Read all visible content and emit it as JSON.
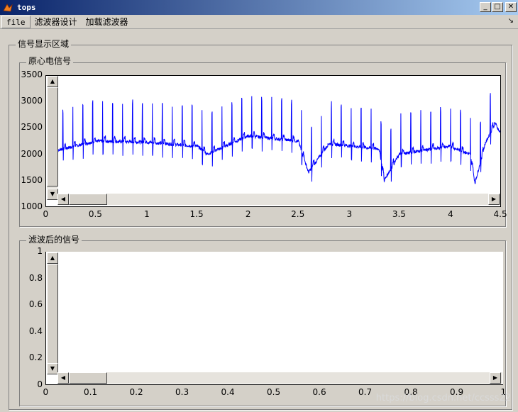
{
  "window": {
    "title": "tops"
  },
  "menu": {
    "items": [
      "file",
      "滤波器设计",
      "加载滤波器"
    ],
    "arrow": "↘"
  },
  "groups": {
    "outer": "信号显示区域",
    "top": "原心电信号",
    "bottom": "滤波后的信号"
  },
  "watermark": "https://blog.csdn.net/ccsss22",
  "chart_data": [
    {
      "type": "line",
      "title": "原心电信号",
      "xlim": [
        0,
        4.5
      ],
      "ylim": [
        1000,
        3500
      ],
      "x_ticks": [
        "0",
        "0.5",
        "1",
        "1.5",
        "2",
        "2.5",
        "3",
        "3.5",
        "4",
        "4.5"
      ],
      "y_ticks": [
        "1000",
        "1500",
        "2000",
        "2500",
        "3000",
        "3500"
      ],
      "grid": false,
      "series": [
        {
          "color": "#0000ff",
          "description_points": [
            [
              0.12,
              2080
            ],
            [
              0.5,
              2250
            ],
            [
              1.0,
              2230
            ],
            [
              1.5,
              2150
            ],
            [
              1.6,
              2000
            ],
            [
              2.0,
              2350
            ],
            [
              2.5,
              2250
            ],
            [
              2.6,
              1650
            ],
            [
              2.8,
              2200
            ],
            [
              3.3,
              2100
            ],
            [
              3.35,
              1500
            ],
            [
              3.5,
              2000
            ],
            [
              4.0,
              2150
            ],
            [
              4.2,
              2000
            ],
            [
              4.25,
              1450
            ],
            [
              4.35,
              2200
            ],
            [
              4.45,
              2600
            ],
            [
              4.5,
              2400
            ]
          ]
        }
      ]
    },
    {
      "type": "line",
      "title": "滤波后的信号",
      "xlim": [
        0,
        1
      ],
      "ylim": [
        0,
        1
      ],
      "x_ticks": [
        "0",
        "0.1",
        "0.2",
        "0.3",
        "0.4",
        "0.5",
        "0.6",
        "0.7",
        "0.8",
        "0.9",
        "1"
      ],
      "y_ticks": [
        "0",
        "0.2",
        "0.4",
        "0.6",
        "0.8",
        "1"
      ],
      "grid": false,
      "series": []
    }
  ]
}
